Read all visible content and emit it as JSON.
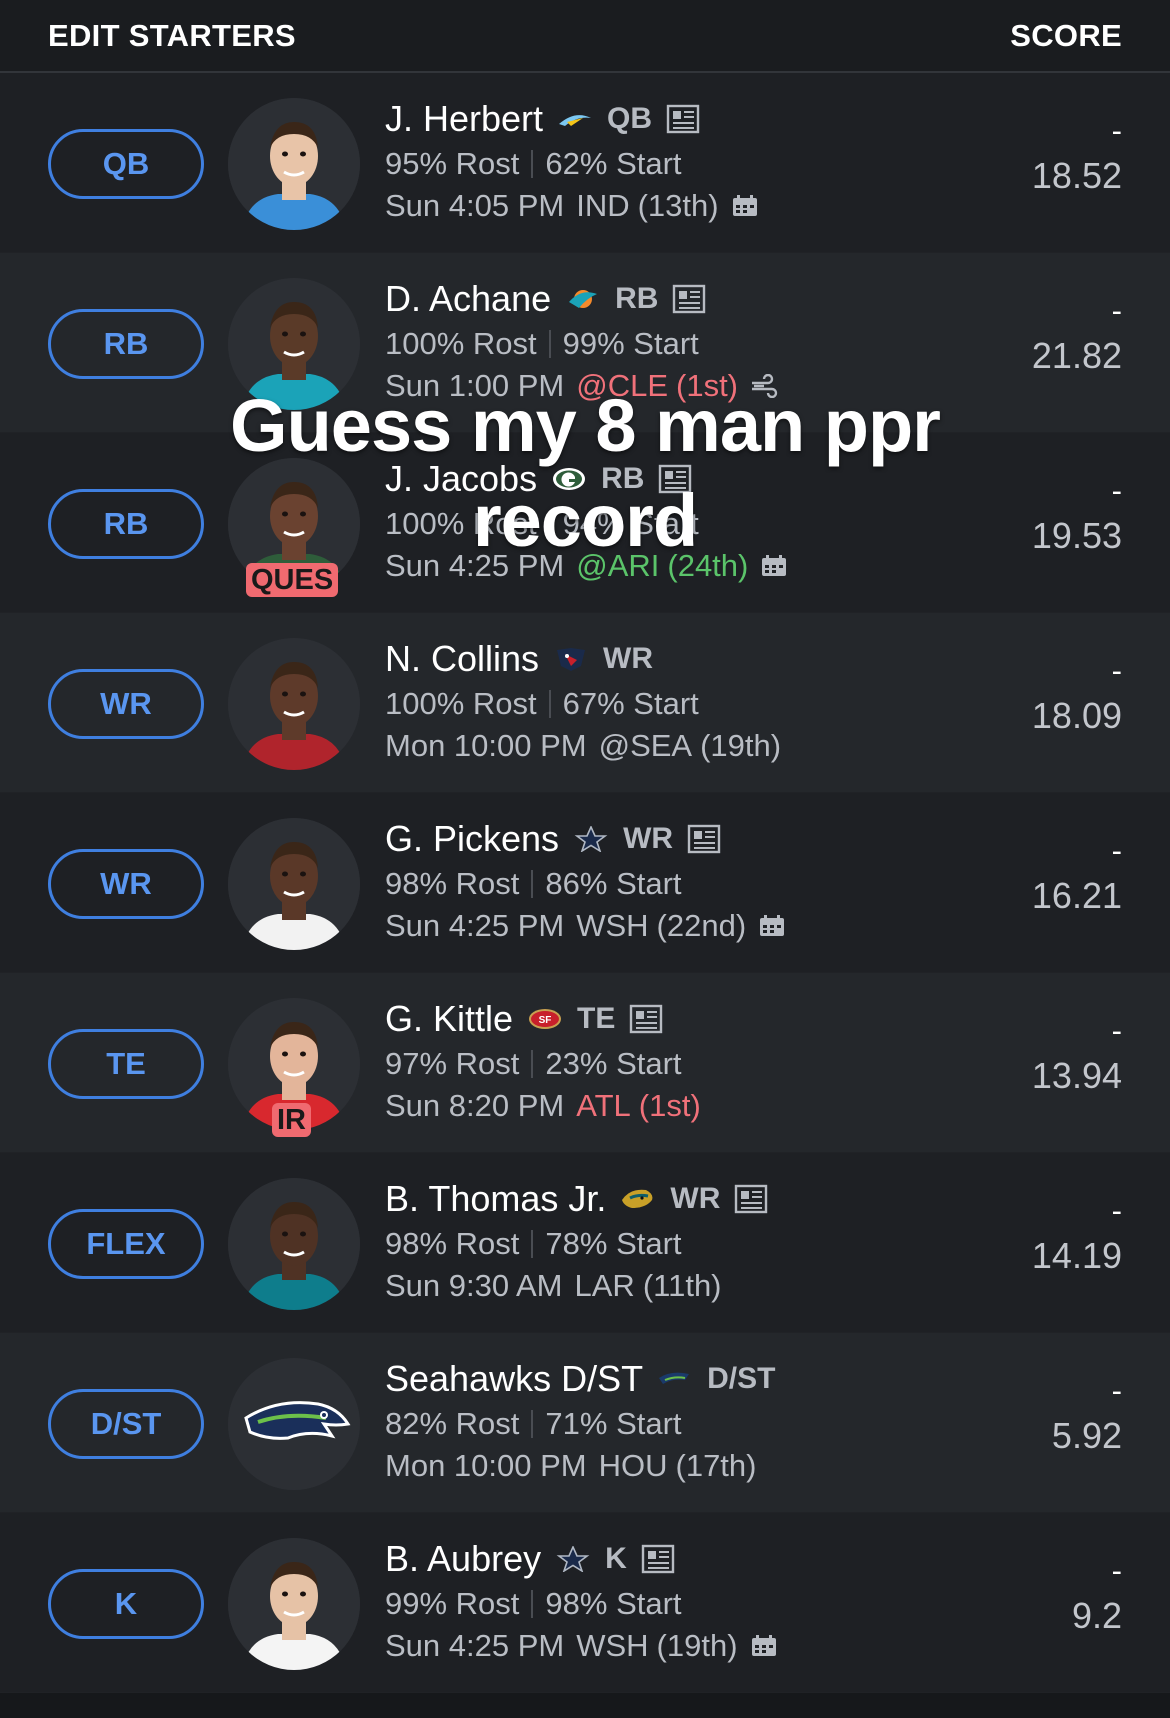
{
  "header": {
    "left": "EDIT STARTERS",
    "right": "SCORE"
  },
  "overlay": {
    "line1": "Guess my 8 man ppr",
    "line2": "record"
  },
  "rows": [
    {
      "slot": "QB",
      "name": "J. Herbert",
      "team_logo": "chargers-logo-icon",
      "pos": "QB",
      "news": true,
      "rost": "95% Rost",
      "start": "62% Start",
      "game_time": "Sun 4:05 PM",
      "opp": "IND",
      "rank": "(13th)",
      "opp_color": "",
      "weather_icon": "calendar-icon",
      "badge": "",
      "dash": "-",
      "proj": "18.52",
      "avatar_skin": "#e8c4a8",
      "jersey": "#3a8fd8"
    },
    {
      "slot": "RB",
      "name": "D. Achane",
      "team_logo": "dolphins-logo-icon",
      "pos": "RB",
      "news": true,
      "rost": "100% Rost",
      "start": "99% Start",
      "game_time": "Sun 1:00 PM",
      "opp": "@CLE",
      "rank": "(1st)",
      "opp_color": "red",
      "weather_icon": "wind-icon",
      "badge": "",
      "dash": "-",
      "proj": "21.82",
      "avatar_skin": "#5a3a28",
      "jersey": "#1ba3b8"
    },
    {
      "slot": "RB",
      "name": "J. Jacobs",
      "team_logo": "packers-logo-icon",
      "pos": "RB",
      "news": true,
      "rost": "100% Rost",
      "start": "94% Start",
      "game_time": "Sun 4:25 PM",
      "opp": "@ARI",
      "rank": "(24th)",
      "opp_color": "green",
      "weather_icon": "calendar-icon",
      "badge": "QUES",
      "dash": "-",
      "proj": "19.53",
      "avatar_skin": "#6a4230",
      "jersey": "#2e5d3a"
    },
    {
      "slot": "WR",
      "name": "N. Collins",
      "team_logo": "texans-logo-icon",
      "pos": "WR",
      "news": false,
      "rost": "100% Rost",
      "start": "67% Start",
      "game_time": "Mon 10:00 PM",
      "opp": "@SEA",
      "rank": "(19th)",
      "opp_color": "",
      "weather_icon": "",
      "badge": "",
      "dash": "-",
      "proj": "18.09",
      "avatar_skin": "#5e3a2a",
      "jersey": "#b0242c"
    },
    {
      "slot": "WR",
      "name": "G. Pickens",
      "team_logo": "cowboys-logo-icon",
      "pos": "WR",
      "news": true,
      "rost": "98% Rost",
      "start": "86% Start",
      "game_time": "Sun 4:25 PM",
      "opp": "WSH",
      "rank": "(22nd)",
      "opp_color": "",
      "weather_icon": "calendar-icon",
      "badge": "",
      "dash": "-",
      "proj": "16.21",
      "avatar_skin": "#5a3828",
      "jersey": "#f2f2f2"
    },
    {
      "slot": "TE",
      "name": "G. Kittle",
      "team_logo": "49ers-logo-icon",
      "pos": "TE",
      "news": true,
      "rost": "97% Rost",
      "start": "23% Start",
      "game_time": "Sun 8:20 PM",
      "opp": "ATL",
      "rank": "(1st)",
      "opp_color": "red",
      "weather_icon": "",
      "badge": "IR",
      "dash": "-",
      "proj": "13.94",
      "avatar_skin": "#e3b59a",
      "jersey": "#d8282e"
    },
    {
      "slot": "FLEX",
      "name": "B. Thomas Jr.",
      "team_logo": "jaguars-logo-icon",
      "pos": "WR",
      "news": true,
      "rost": "98% Rost",
      "start": "78% Start",
      "game_time": "Sun 9:30 AM",
      "opp": "LAR",
      "rank": "(11th)",
      "opp_color": "",
      "weather_icon": "",
      "badge": "",
      "dash": "-",
      "proj": "14.19",
      "avatar_skin": "#4f3224",
      "jersey": "#0e7d8c"
    },
    {
      "slot": "D/ST",
      "name": "Seahawks D/ST",
      "team_logo": "seahawks-logo-icon",
      "pos": "D/ST",
      "news": false,
      "rost": "82% Rost",
      "start": "71% Start",
      "game_time": "Mon 10:00 PM",
      "opp": "HOU",
      "rank": "(17th)",
      "opp_color": "",
      "weather_icon": "",
      "badge": "",
      "dash": "-",
      "proj": "5.92",
      "avatar_skin": "",
      "jersey": ""
    },
    {
      "slot": "K",
      "name": "B. Aubrey",
      "team_logo": "cowboys-logo-icon",
      "pos": "K",
      "news": true,
      "rost": "99% Rost",
      "start": "98% Start",
      "game_time": "Sun 4:25 PM",
      "opp": "WSH",
      "rank": "(19th)",
      "opp_color": "",
      "weather_icon": "calendar-icon",
      "badge": "",
      "dash": "-",
      "proj": "9.2",
      "avatar_skin": "#e6c2a6",
      "jersey": "#f4f4f4"
    }
  ],
  "colors": {
    "accent": "#3f7fe0",
    "injury": "#f06a70",
    "bad_matchup": "#f0717a",
    "good_matchup": "#5bc46a"
  }
}
